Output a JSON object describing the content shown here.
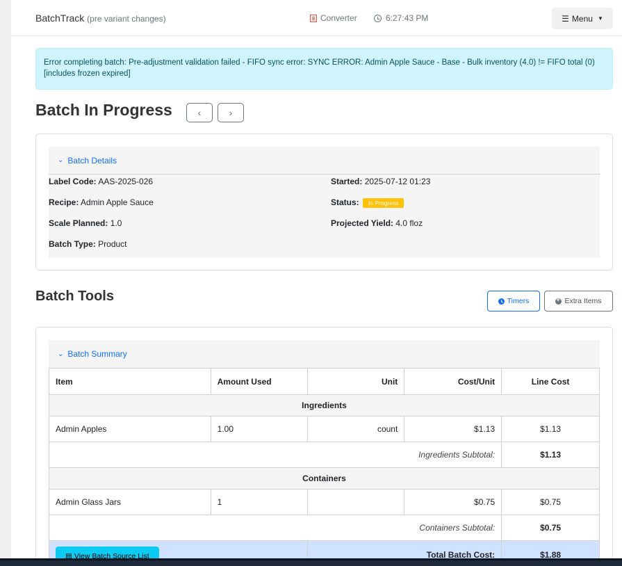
{
  "topbar": {
    "brand": "BatchTrack",
    "brand_sub": "(pre variant changes)",
    "converter_label": "Converter",
    "time": "6:27:43 PM",
    "menu_label": "Menu"
  },
  "alert": {
    "message": "Error completing batch: Pre-adjustment validation failed - FIFO sync error: SYNC ERROR: Admin Apple Sauce - Base - Bulk inventory (4.0) != FIFO total (0) [includes frozen expired]"
  },
  "batch": {
    "title": "Batch In Progress",
    "prev_glyph": "‹",
    "next_glyph": "›",
    "details_header": "Batch Details",
    "label_code_label": "Label Code:",
    "label_code": "AAS-2025-026",
    "recipe_label": "Recipe:",
    "recipe": "Admin Apple Sauce",
    "scale_label": "Scale Planned:",
    "scale": "1.0",
    "type_label": "Batch Type:",
    "type": "Product",
    "started_label": "Started:",
    "started": "2025-07-12 01:23",
    "status_label": "Status:",
    "status": "In Progress",
    "yield_label": "Projected Yield:",
    "yield": "4.0 floz"
  },
  "tools": {
    "title": "Batch Tools",
    "timers_label": "Timers",
    "extra_label": "Extra Items"
  },
  "summary": {
    "header": "Batch Summary",
    "columns": [
      "Item",
      "Amount Used",
      "Unit",
      "Cost/Unit",
      "Line Cost"
    ],
    "ingredients_group": "Ingredients",
    "ingredients": [
      {
        "item": "Admin Apples",
        "amount": "1.00",
        "unit": "count",
        "cost_unit": "$1.13",
        "line_cost": "$1.13"
      }
    ],
    "ingredients_subtotal_label": "Ingredients Subtotal:",
    "ingredients_subtotal": "$1.13",
    "containers_group": "Containers",
    "containers": [
      {
        "item": "Admin Glass Jars",
        "amount": "1",
        "unit": "",
        "cost_unit": "$0.75",
        "line_cost": "$0.75"
      }
    ],
    "containers_subtotal_label": "Containers Subtotal:",
    "containers_subtotal": "$0.75",
    "source_button": "View Batch Source List",
    "total_label": "Total Batch Cost:",
    "total": "$1.88"
  },
  "colors": {
    "accent": "#0d6efd",
    "alert_bg": "#cff4fc",
    "status_badge": "#ffc107",
    "total_row": "#cfe2ff",
    "source_button": "#0dcaf0"
  }
}
